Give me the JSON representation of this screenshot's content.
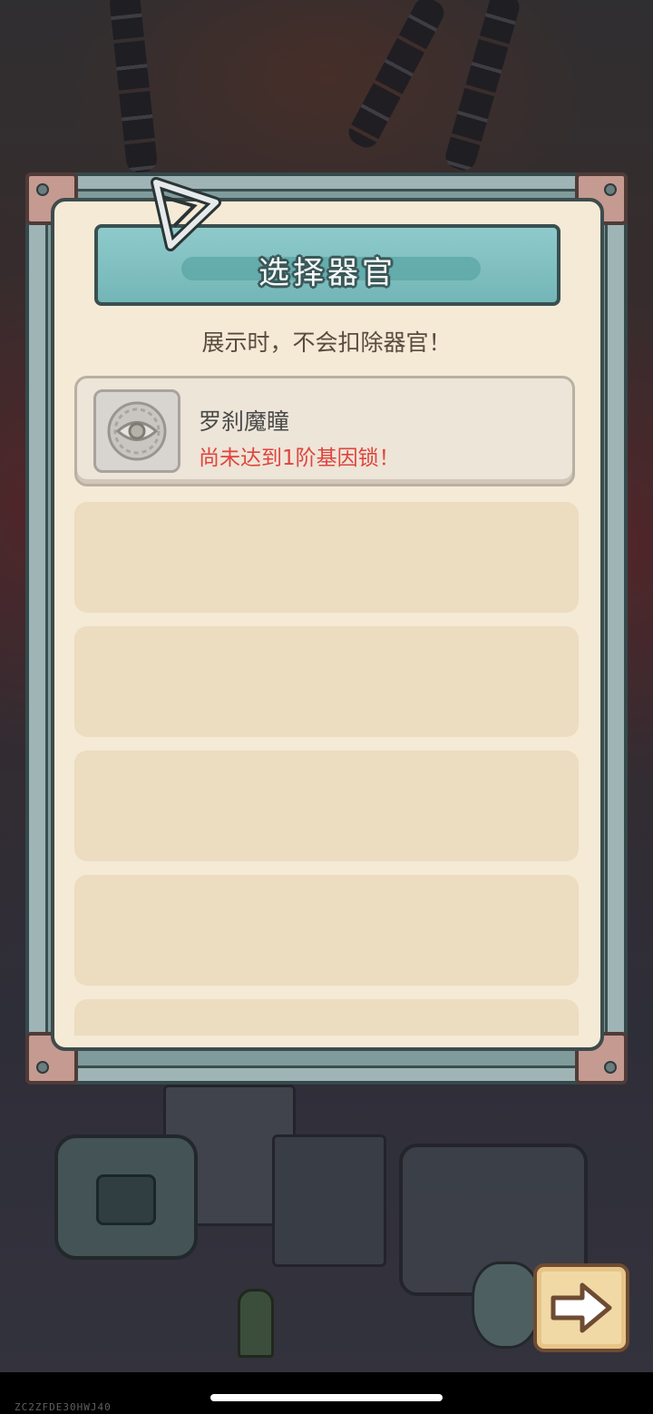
{
  "dialog": {
    "title": "选择器官",
    "subtitle": "展示时，不会扣除器官！"
  },
  "organs": [
    {
      "name": "罗刹魔瞳",
      "status": "尚未达到1阶基因锁！",
      "icon": "eye-icon",
      "locked": true
    }
  ],
  "empty_slots": 5,
  "buttons": {
    "next": {
      "icon": "arrow-right-icon"
    }
  },
  "colors": {
    "status_warning": "#e0443e",
    "header_teal": "#7bbcbd",
    "panel_cream": "#f5ead6",
    "button_gold": "#f1d9a6"
  },
  "system": {
    "device_id": "ZC2ZFDE30HWJ40"
  }
}
